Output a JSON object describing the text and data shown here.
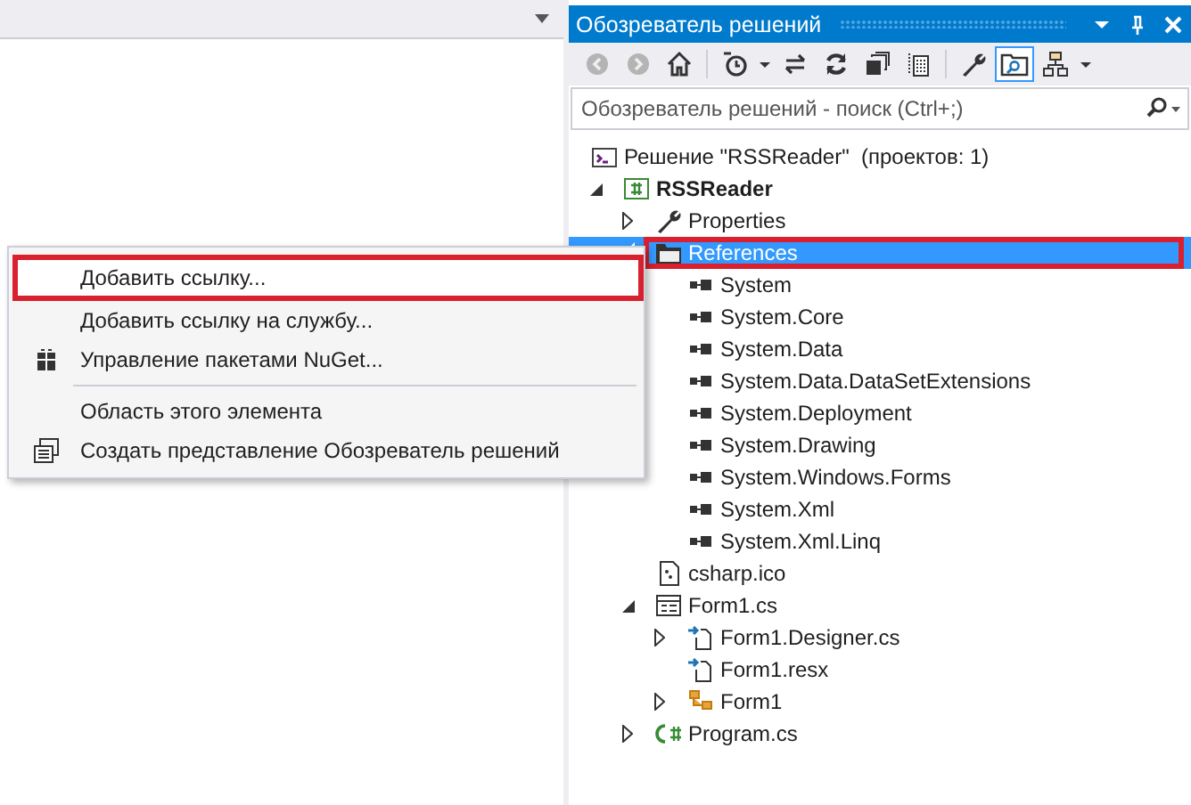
{
  "explorer": {
    "title": "Обозреватель решений",
    "toolbar": [
      {
        "kind": "back",
        "disabled": true,
        "selected": false
      },
      {
        "kind": "forward",
        "disabled": true,
        "selected": false
      },
      {
        "kind": "home",
        "disabled": false,
        "selected": false
      },
      {
        "kind": "separator"
      },
      {
        "kind": "history",
        "disabled": false,
        "selected": false
      },
      {
        "kind": "dropdown",
        "disabled": false,
        "selected": false
      },
      {
        "kind": "sync",
        "disabled": false,
        "selected": false
      },
      {
        "kind": "refresh",
        "disabled": false,
        "selected": false
      },
      {
        "kind": "collapse",
        "disabled": false,
        "selected": false
      },
      {
        "kind": "show-all",
        "disabled": false,
        "selected": false
      },
      {
        "kind": "separator"
      },
      {
        "kind": "properties",
        "disabled": false,
        "selected": false
      },
      {
        "kind": "preview",
        "disabled": false,
        "selected": true
      },
      {
        "kind": "class-view",
        "disabled": false,
        "selected": false
      },
      {
        "kind": "dropdown",
        "disabled": false,
        "selected": false
      }
    ],
    "search": {
      "placeholder": "Обозреватель решений - поиск (Ctrl+;)"
    },
    "tree": [
      {
        "label": "Решение \"RSSReader\"  (проектов: 1)",
        "kind": "solution",
        "selected": false,
        "highlighted": false,
        "children": [
          {
            "label": "RSSReader",
            "kind": "project",
            "expanded": true,
            "selected": false,
            "highlighted": false,
            "children": [
              {
                "label": "Properties",
                "kind": "properties",
                "expanded": false,
                "selected": false,
                "highlighted": false
              },
              {
                "label": "References",
                "kind": "references",
                "expanded": true,
                "selected": true,
                "highlighted": true,
                "children": [
                  {
                    "label": "System",
                    "kind": "reference",
                    "selected": false,
                    "highlighted": false
                  },
                  {
                    "label": "System.Core",
                    "kind": "reference",
                    "selected": false,
                    "highlighted": false
                  },
                  {
                    "label": "System.Data",
                    "kind": "reference",
                    "selected": false,
                    "highlighted": false
                  },
                  {
                    "label": "System.Data.DataSetExtensions",
                    "kind": "reference",
                    "selected": false,
                    "highlighted": false
                  },
                  {
                    "label": "System.Deployment",
                    "kind": "reference",
                    "selected": false,
                    "highlighted": false
                  },
                  {
                    "label": "System.Drawing",
                    "kind": "reference",
                    "selected": false,
                    "highlighted": false
                  },
                  {
                    "label": "System.Windows.Forms",
                    "kind": "reference",
                    "selected": false,
                    "highlighted": false
                  },
                  {
                    "label": "System.Xml",
                    "kind": "reference",
                    "selected": false,
                    "highlighted": false
                  },
                  {
                    "label": "System.Xml.Linq",
                    "kind": "reference",
                    "selected": false,
                    "highlighted": false
                  }
                ]
              },
              {
                "label": "csharp.ico",
                "kind": "image-file",
                "selected": false,
                "highlighted": false
              },
              {
                "label": "Form1.cs",
                "kind": "form",
                "expanded": true,
                "selected": false,
                "highlighted": false,
                "children": [
                  {
                    "label": "Form1.Designer.cs",
                    "kind": "dependent-file",
                    "expanded": false,
                    "selected": false,
                    "highlighted": false
                  },
                  {
                    "label": "Form1.resx",
                    "kind": "dependent-file",
                    "selected": false,
                    "highlighted": false
                  },
                  {
                    "label": "Form1",
                    "kind": "class",
                    "expanded": false,
                    "selected": false,
                    "highlighted": false
                  }
                ]
              },
              {
                "label": "Program.cs",
                "kind": "code-file",
                "expanded": false,
                "selected": false,
                "highlighted": false
              }
            ]
          }
        ]
      }
    ]
  },
  "context_menu": [
    {
      "kind": "item",
      "label": "Добавить ссылку...",
      "highlighted": true
    },
    {
      "kind": "item",
      "label": "Добавить ссылку на службу...",
      "highlighted": false
    },
    {
      "kind": "package",
      "label": "Управление пакетами NuGet...",
      "highlighted": false
    },
    {
      "kind": "separator"
    },
    {
      "kind": "item",
      "label": "Область этого элемента",
      "highlighted": false
    },
    {
      "kind": "new-view",
      "label": "Создать представление Обозреватель решений",
      "highlighted": false
    }
  ]
}
